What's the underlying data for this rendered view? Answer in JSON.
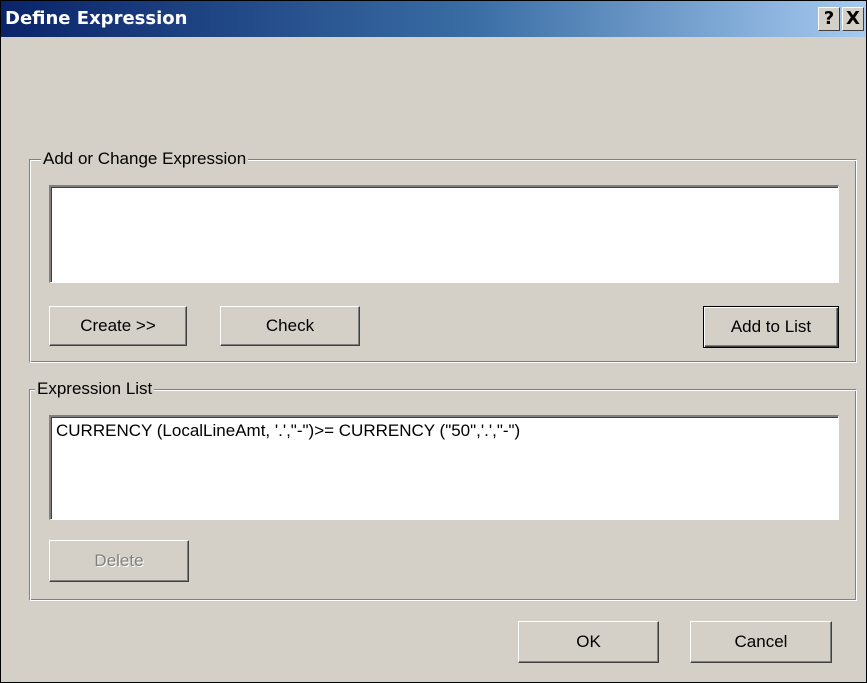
{
  "window": {
    "title": "Define Expression",
    "help_button": "?",
    "close_button": "X"
  },
  "add_group": {
    "label": "Add or Change Expression",
    "expression_value": "",
    "create_button": "Create >>",
    "check_button": "Check",
    "add_to_list_button": "Add to List"
  },
  "list_group": {
    "label": "Expression List",
    "items": [
      "CURRENCY (LocalLineAmt, '.',\"-\")>= CURRENCY (\"50\",'.',\"-\")"
    ],
    "delete_button": "Delete"
  },
  "footer": {
    "ok_button": "OK",
    "cancel_button": "Cancel"
  },
  "colors": {
    "dialog_face": "#d4d0c8",
    "title_start": "#0a246a",
    "title_end": "#a6caf0",
    "disabled_text": "#808080"
  }
}
